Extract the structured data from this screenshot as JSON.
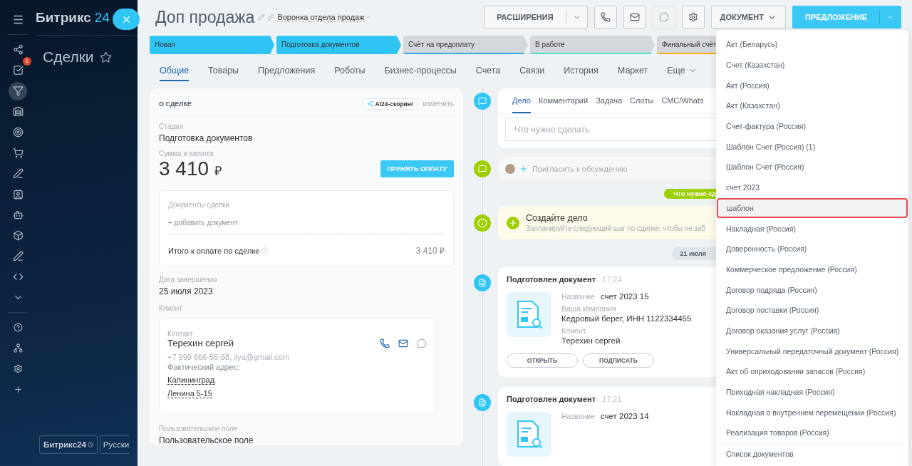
{
  "sidebar": {
    "items": [
      {
        "kind": "sites",
        "selected": false
      },
      {
        "kind": "tasks",
        "selected": false,
        "badge": "1"
      },
      {
        "kind": "crm",
        "selected": true
      },
      {
        "kind": "store",
        "selected": false
      },
      {
        "kind": "target",
        "selected": false
      },
      {
        "kind": "cart",
        "selected": false
      },
      {
        "kind": "sign",
        "selected": false
      },
      {
        "kind": "contacts",
        "selected": false
      },
      {
        "kind": "robot",
        "selected": false
      },
      {
        "kind": "box",
        "selected": false
      },
      {
        "kind": "marketing",
        "selected": false
      },
      {
        "kind": "code",
        "selected": false
      },
      {
        "kind": "more",
        "selected": false
      }
    ],
    "bottom_items": [
      {
        "kind": "help"
      },
      {
        "kind": "network"
      },
      {
        "kind": "settings"
      },
      {
        "kind": "add"
      }
    ]
  },
  "brand": {
    "name": "Битрикс",
    "number": "24"
  },
  "page_title": "Сделки",
  "footer_buttons": [
    {
      "kind": "logo",
      "label": "Битрикс24"
    },
    {
      "kind": "language",
      "label": "Русски"
    }
  ],
  "header": {
    "title": "Доп продажа",
    "pipeline": "Воронка отдела продаж",
    "extensions": "РАСШИРЕНИЯ",
    "icon_buttons": [
      {
        "kind": "phone",
        "disabled": false
      },
      {
        "kind": "mail",
        "disabled": false
      },
      {
        "kind": "chat",
        "disabled": true
      },
      {
        "kind": "settings",
        "disabled": false
      }
    ],
    "document": "ДОКУМЕНТ",
    "offer": "ПРЕДЛОЖЕНИЕ"
  },
  "stages": [
    {
      "label": "Новая",
      "reached": true,
      "color": "#2fc6f6"
    },
    {
      "label": "Подготовка документов",
      "reached": true,
      "color": "#2fc6f6"
    },
    {
      "label": "Счёт на предоплату",
      "reached": false,
      "color": "#39a8ef"
    },
    {
      "label": "В работе",
      "reached": false,
      "color": "#47e4c2"
    },
    {
      "label": "Финальный счёт",
      "reached": false,
      "color": "#ffa900"
    }
  ],
  "tabs": [
    {
      "label": "Общие",
      "selected": true,
      "kind": "tab"
    },
    {
      "label": "Товары",
      "selected": false,
      "kind": "tab"
    },
    {
      "label": "Предложения",
      "selected": false,
      "kind": "tab"
    },
    {
      "label": "Роботы",
      "selected": false,
      "kind": "tab"
    },
    {
      "label": "Бизнес-процессы",
      "selected": false,
      "kind": "tab"
    },
    {
      "label": "Счета",
      "selected": false,
      "kind": "tab"
    },
    {
      "label": "Связи",
      "selected": false,
      "kind": "tab"
    },
    {
      "label": "История",
      "selected": false,
      "kind": "tab"
    },
    {
      "label": "Маркет",
      "selected": false,
      "kind": "tab"
    },
    {
      "label": "Еще",
      "selected": false,
      "kind": "more"
    }
  ],
  "deal": {
    "title": "О СДЕЛКЕ",
    "scoring": "AI24-скоринг",
    "edit_link": "изменить",
    "stage_label": "Стадия",
    "stage_value": "Подготовка документов",
    "amount_label": "Сумма и валюта",
    "amount": "3 410",
    "currency": "₽",
    "pay_button": "ПРИНЯТЬ ОПЛАТУ",
    "documents": {
      "title": "Документы сделки",
      "add_link": "+ добавить документ",
      "total_label": "Итого к оплате по сделке",
      "total": "3 410 ₽"
    },
    "close_date_label": "Дата завершения",
    "close_date": "25 июля 2023",
    "client_label": "Клиент",
    "contact": {
      "label": "Контакт",
      "name": "Терехин сергей",
      "details": "+7 999 666-55-88, ilya@gmail.com",
      "address_label": "Фактический адрес:",
      "address_lines": [
        "Калининград",
        "Ленина 5-15"
      ]
    },
    "custom_label": "Пользовательское поле",
    "custom_value": "Пользовательское поле"
  },
  "timeline": {
    "editor": {
      "tabs": [
        {
          "label": "Дело",
          "selected": true
        },
        {
          "label": "Комментарий",
          "selected": false
        },
        {
          "label": "Задача",
          "selected": false
        },
        {
          "label": "Слоты",
          "selected": false
        },
        {
          "label": "СМС/Whats",
          "selected": false
        }
      ],
      "placeholder": "Что нужно сделать"
    },
    "invite": "Пригласить к обсуждению",
    "marker": "Что нужно сд",
    "todo": {
      "title": "Создайте дело",
      "hint": "Запланируйте следующий шаг по сделке, чтобы не заб"
    },
    "date": "21 июля",
    "documents": [
      {
        "title": "Подготовлен документ",
        "time": "17:24",
        "fields": [
          {
            "label": "Название",
            "value": "счет 2023 15",
            "inline": true
          },
          {
            "label": "Ваша компания",
            "value": "Кедровый берег, ИНН 1122334455",
            "inline": false
          },
          {
            "label": "Клиент",
            "value": "Терехин сергей",
            "inline": false
          }
        ],
        "buttons": [
          "ОТКРЫТЬ",
          "ПОДПИСАТЬ"
        ]
      },
      {
        "title": "Подготовлен документ",
        "time": "17:21",
        "fields": [
          {
            "label": "Название",
            "value": "счет 2023 14",
            "inline": true
          }
        ]
      }
    ]
  },
  "document_menu": {
    "items": [
      {
        "label": "Акт (Беларусь)",
        "selected": false
      },
      {
        "label": "Счет (Казахстан)",
        "selected": false
      },
      {
        "label": "Акт (Россия)",
        "selected": false
      },
      {
        "label": "Акт (Казахстан)",
        "selected": false
      },
      {
        "label": "Счет-фактура (Россия)",
        "selected": false
      },
      {
        "label": "Шаблон Счет (Россия) (1)",
        "selected": false
      },
      {
        "label": "Шаблон Счет (Россия)",
        "selected": false
      },
      {
        "label": "счет 2023",
        "selected": false
      },
      {
        "label": "шаблон",
        "selected": true
      },
      {
        "label": "Накладная (Россия)",
        "selected": false
      },
      {
        "label": "Доверенность (Россия)",
        "selected": false
      },
      {
        "label": "Коммерческое предложение (Россия)",
        "selected": false
      },
      {
        "label": "Договор подряда (Россия)",
        "selected": false
      },
      {
        "label": "Договор поставки (Россия)",
        "selected": false
      },
      {
        "label": "Договор оказания услуг (Россия)",
        "selected": false
      },
      {
        "label": "Универсальный передаточный документ (Россия)",
        "selected": false
      },
      {
        "label": "Акт об оприходовании запасов (Россия)",
        "selected": false
      },
      {
        "label": "Приходная накладная (Россия)",
        "selected": false
      },
      {
        "label": "Накладная о внутреннем перемещении (Россия)",
        "selected": false
      },
      {
        "label": "Реализация товаров (Россия)",
        "selected": false
      }
    ],
    "footer": "Список документов"
  }
}
